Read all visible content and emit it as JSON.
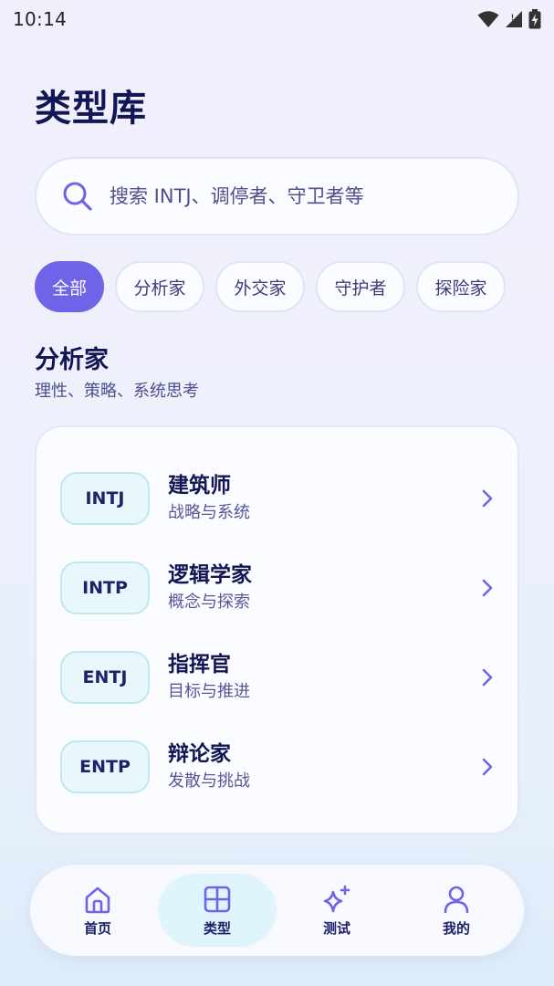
{
  "status_bar": {
    "time": "10:14"
  },
  "header": {
    "title": "类型库"
  },
  "search": {
    "placeholder": "搜索 INTJ、调停者、守卫者等"
  },
  "filters": [
    {
      "label": "全部",
      "active": true
    },
    {
      "label": "分析家",
      "active": false
    },
    {
      "label": "外交家",
      "active": false
    },
    {
      "label": "守护者",
      "active": false
    },
    {
      "label": "探险家",
      "active": false
    }
  ],
  "section": {
    "title": "分析家",
    "subtitle": "理性、策略、系统思考"
  },
  "types": [
    {
      "code": "INTJ",
      "name": "建筑师",
      "desc": "战略与系统"
    },
    {
      "code": "INTP",
      "name": "逻辑学家",
      "desc": "概念与探索"
    },
    {
      "code": "ENTJ",
      "name": "指挥官",
      "desc": "目标与推进"
    },
    {
      "code": "ENTP",
      "name": "辩论家",
      "desc": "发散与挑战"
    }
  ],
  "nav": [
    {
      "label": "首页",
      "icon": "home-icon",
      "active": false
    },
    {
      "label": "类型",
      "icon": "grid-icon",
      "active": true
    },
    {
      "label": "测试",
      "icon": "sparkle-icon",
      "active": false
    },
    {
      "label": "我的",
      "icon": "user-icon",
      "active": false
    }
  ],
  "colors": {
    "accent": "#6f64e8",
    "title": "#121654",
    "badge_bg": "#e8f7fc",
    "nav_active_bg": "#dff4fb"
  }
}
